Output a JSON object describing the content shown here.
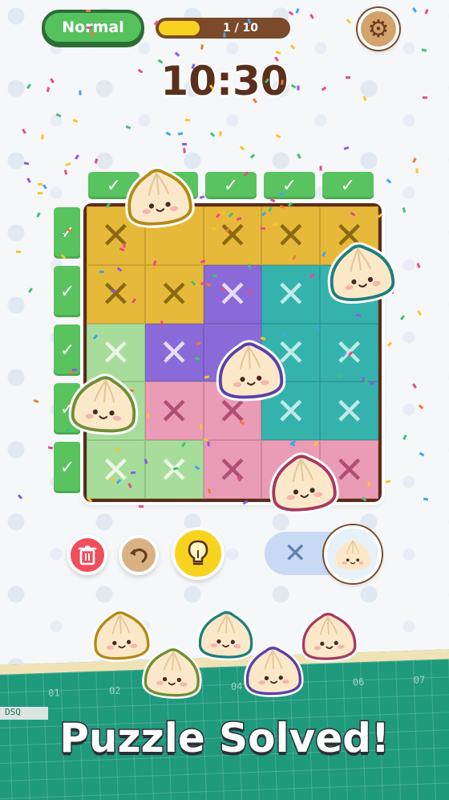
{
  "header": {
    "difficulty": "Normal",
    "progress_text": "1 / 10",
    "progress_fraction": 0.32,
    "settings_icon": "gear-icon"
  },
  "timer": "10:30",
  "board": {
    "column_checks": [
      "✓",
      "✓",
      "✓",
      "✓",
      "✓"
    ],
    "row_checks": [
      "✓",
      "✓",
      "✓",
      "✓",
      "✓"
    ],
    "rows": [
      [
        {
          "c": "#e7b93a",
          "m": "x"
        },
        {
          "c": "#e7b93a",
          "m": ""
        },
        {
          "c": "#e7b93a",
          "m": "x"
        },
        {
          "c": "#e7b93a",
          "m": "x"
        },
        {
          "c": "#e7b93a",
          "m": "x"
        }
      ],
      [
        {
          "c": "#e7b93a",
          "m": "x"
        },
        {
          "c": "#e7b93a",
          "m": "x"
        },
        {
          "c": "#8a6ad8",
          "m": "x"
        },
        {
          "c": "#36b2ad",
          "m": "x"
        },
        {
          "c": "#36b2ad",
          "m": ""
        }
      ],
      [
        {
          "c": "#a8dc9a",
          "m": "x"
        },
        {
          "c": "#8a6ad8",
          "m": "x"
        },
        {
          "c": "#8a6ad8",
          "m": ""
        },
        {
          "c": "#36b2ad",
          "m": "x"
        },
        {
          "c": "#36b2ad",
          "m": "x"
        }
      ],
      [
        {
          "c": "#a8dc9a",
          "m": ""
        },
        {
          "c": "#ea9bb6",
          "m": "x"
        },
        {
          "c": "#ea9bb6",
          "m": "x"
        },
        {
          "c": "#36b2ad",
          "m": "x"
        },
        {
          "c": "#36b2ad",
          "m": "x"
        }
      ],
      [
        {
          "c": "#a8dc9a",
          "m": "x"
        },
        {
          "c": "#a8dc9a",
          "m": "x"
        },
        {
          "c": "#ea9bb6",
          "m": "x"
        },
        {
          "c": "#ea9bb6",
          "m": ""
        },
        {
          "c": "#ea9bb6",
          "m": "x"
        }
      ]
    ],
    "mark_colors": {
      "#e7b93a": "#8a6a10",
      "#8a6ad8": "#e7dcff",
      "#36b2ad": "#bdebe7",
      "#a8dc9a": "#e9f7e4",
      "#ea9bb6": "#b04e74"
    }
  },
  "actions": {
    "delete_icon": "trash-icon",
    "undo_icon": "undo-icon",
    "hint_icon": "lightbulb-icon",
    "mode_mark": "✕",
    "mode_icon": "dumpling-icon"
  },
  "footer": {
    "ruler_numbers": [
      "01",
      "02",
      "03",
      "04",
      "05",
      "06",
      "07"
    ],
    "mat_label": "DSQ",
    "message": "Puzzle Solved!"
  },
  "colors": {
    "green": "#56c25d",
    "brown": "#5b2b1a",
    "yellow": "#f7d320"
  }
}
